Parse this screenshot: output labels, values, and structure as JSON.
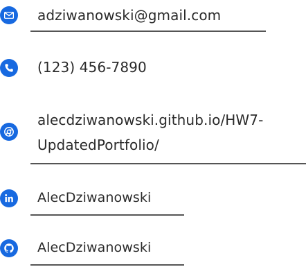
{
  "contacts": {
    "email": {
      "text": "adziwanowski@gmail.com",
      "icon": "mail-icon"
    },
    "phone": {
      "text": "(123) 456-7890",
      "icon": "phone-icon"
    },
    "website": {
      "line1": "alecdziwanowski.github.io/HW7-",
      "line2": "UpdatedPortfolio/",
      "icon": "globe-icon"
    },
    "linkedin": {
      "text": "AlecDziwanowski",
      "icon": "linkedin-icon"
    },
    "github": {
      "text": "AlecDziwanowski",
      "icon": "github-icon"
    }
  },
  "colors": {
    "accent": "#1769e0",
    "text": "#2b2b2b",
    "underline": "#555555"
  }
}
